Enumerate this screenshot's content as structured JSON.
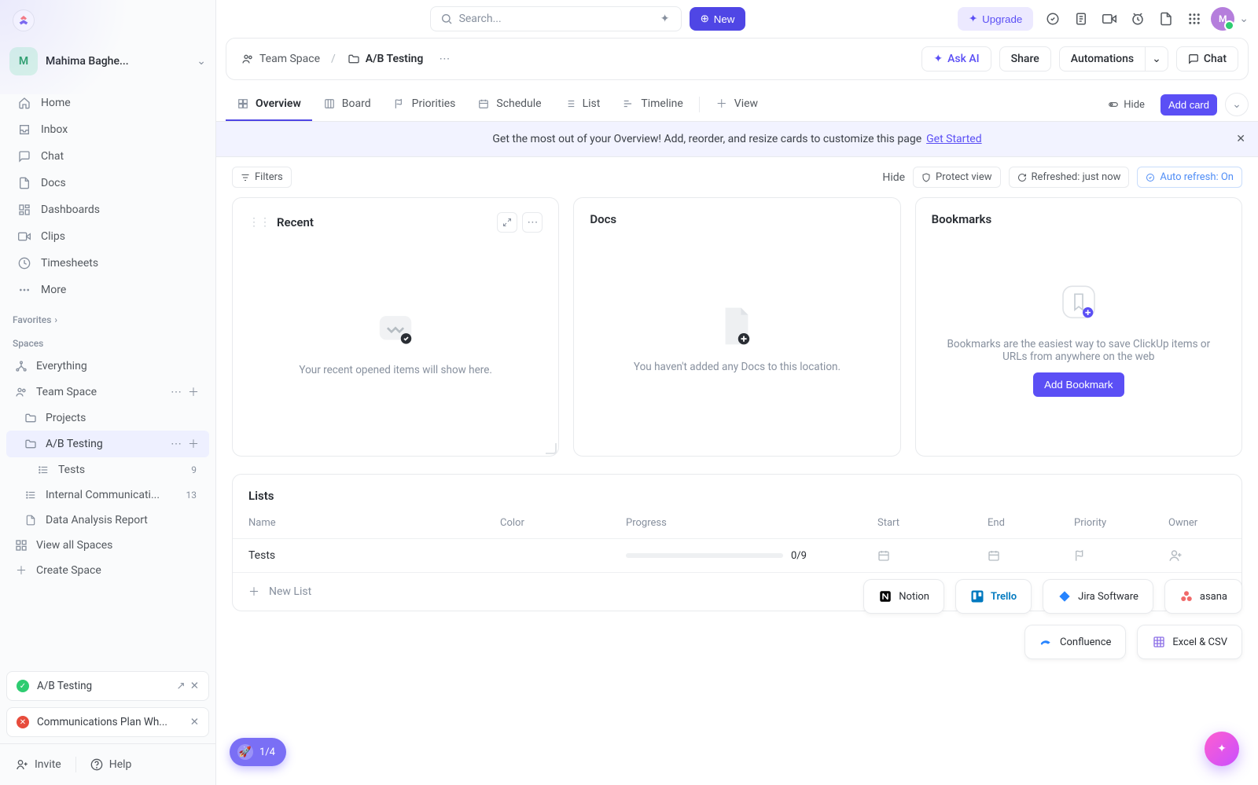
{
  "workspace": {
    "initial": "M",
    "name": "Mahima Baghe..."
  },
  "nav": {
    "items": [
      {
        "key": "home",
        "label": "Home"
      },
      {
        "key": "inbox",
        "label": "Inbox"
      },
      {
        "key": "chat",
        "label": "Chat"
      },
      {
        "key": "docs",
        "label": "Docs"
      },
      {
        "key": "dashboards",
        "label": "Dashboards"
      },
      {
        "key": "clips",
        "label": "Clips"
      },
      {
        "key": "timesheets",
        "label": "Timesheets"
      },
      {
        "key": "more",
        "label": "More"
      }
    ],
    "favorites_label": "Favorites",
    "spaces_label": "Spaces",
    "everything": "Everything",
    "team_space": "Team Space",
    "projects": "Projects",
    "ab_testing": "A/B Testing",
    "tests": "Tests",
    "tests_count": "9",
    "internal": "Internal Communicati...",
    "internal_count": "13",
    "data_report": "Data Analysis Report",
    "view_all": "View all Spaces",
    "create_space": "Create Space"
  },
  "toasts": {
    "ok_text": "A/B Testing",
    "err_text": "Communications Plan Wh..."
  },
  "footer": {
    "invite": "Invite",
    "help": "Help"
  },
  "topbar": {
    "search_placeholder": "Search...",
    "new": "New",
    "upgrade": "Upgrade"
  },
  "breadcrumb": {
    "team_space": "Team Space",
    "ab_testing": "A/B Testing",
    "ask_ai": "Ask AI",
    "share": "Share",
    "automations": "Automations",
    "chat": "Chat"
  },
  "tabs": {
    "items": [
      {
        "key": "overview",
        "label": "Overview",
        "active": true
      },
      {
        "key": "board",
        "label": "Board"
      },
      {
        "key": "priorities",
        "label": "Priorities"
      },
      {
        "key": "schedule",
        "label": "Schedule"
      },
      {
        "key": "list",
        "label": "List"
      },
      {
        "key": "timeline",
        "label": "Timeline"
      }
    ],
    "view": "View",
    "hide": "Hide",
    "add_card": "Add card"
  },
  "banner": {
    "text": "Get the most out of your Overview! Add, reorder, and resize cards to customize this page",
    "link": "Get Started"
  },
  "toolbar": {
    "filters": "Filters",
    "hide": "Hide",
    "protect": "Protect view",
    "refreshed": "Refreshed: just now",
    "auto": "Auto refresh: On"
  },
  "cards": {
    "recent": {
      "title": "Recent",
      "empty": "Your recent opened items will show here."
    },
    "docs": {
      "title": "Docs",
      "empty": "You haven't added any Docs to this location."
    },
    "bookmarks": {
      "title": "Bookmarks",
      "empty": "Bookmarks are the easiest way to save ClickUp items or URLs from anywhere on the web",
      "button": "Add Bookmark"
    }
  },
  "lists": {
    "title": "Lists",
    "cols": {
      "name": "Name",
      "color": "Color",
      "progress": "Progress",
      "start": "Start",
      "end": "End",
      "priority": "Priority",
      "owner": "Owner"
    },
    "rows": [
      {
        "name": "Tests",
        "progress_text": "0/9",
        "progress_pct": 0
      }
    ],
    "new_list": "New List"
  },
  "imports": {
    "row1": [
      "Notion",
      "Trello",
      "Jira Software",
      "asana"
    ],
    "row2": [
      "Confluence",
      "Excel & CSV"
    ]
  },
  "onboarding": "1/4",
  "avatar_initial": "M"
}
